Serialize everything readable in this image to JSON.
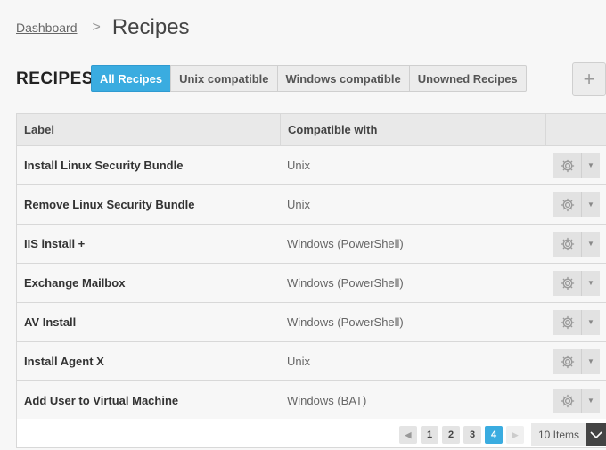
{
  "breadcrumb": {
    "link": "Dashboard",
    "separator": ">",
    "current": "Recipes"
  },
  "section_title": "RECIPES",
  "filters": [
    {
      "label": "All Recipes",
      "active": true
    },
    {
      "label": "Unix compatible",
      "active": false
    },
    {
      "label": "Windows compatible",
      "active": false
    },
    {
      "label": "Unowned Recipes",
      "active": false
    }
  ],
  "add_button": {
    "label": "+"
  },
  "table": {
    "columns": [
      "Label",
      "Compatible with",
      ""
    ],
    "rows": [
      {
        "label": "Install Linux Security Bundle",
        "compat": "Unix"
      },
      {
        "label": "Remove Linux Security Bundle",
        "compat": "Unix"
      },
      {
        "label": "IIS install +",
        "compat": "Windows (PowerShell)"
      },
      {
        "label": "Exchange Mailbox",
        "compat": "Windows (PowerShell)"
      },
      {
        "label": "AV Install",
        "compat": "Windows (PowerShell)"
      },
      {
        "label": "Install Agent X",
        "compat": "Unix"
      },
      {
        "label": "Add User to Virtual Machine",
        "compat": "Windows (BAT)"
      }
    ]
  },
  "pagination": {
    "prev": "◀",
    "next": "▶",
    "pages": [
      "1",
      "2",
      "3",
      "4"
    ],
    "current_page": "4",
    "items_per_page": "10 Items"
  },
  "colors": {
    "accent": "#3aace0"
  },
  "icons": {
    "row_action": "gear-icon",
    "row_menu": "caret-down-icon"
  }
}
